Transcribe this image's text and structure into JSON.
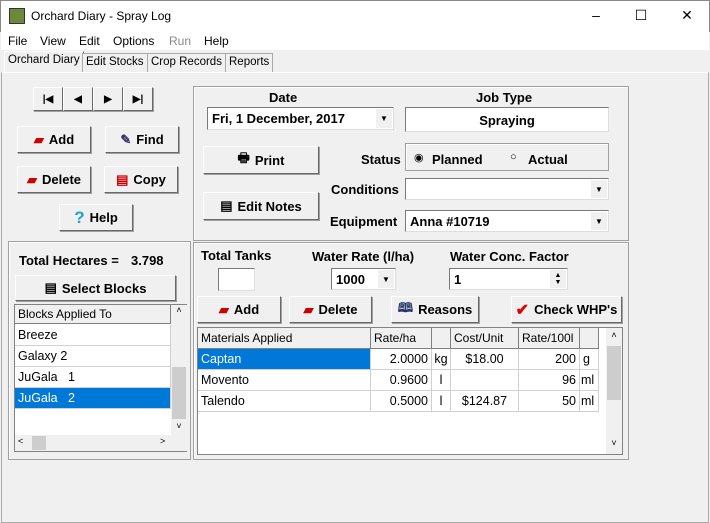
{
  "window": {
    "title": "Orchard Diary - Spray Log",
    "controls": [
      "–",
      "☐",
      "✕"
    ]
  },
  "menu": [
    "File",
    "View",
    "Edit",
    "Options",
    "Run",
    "Help"
  ],
  "tabs": [
    "Orchard Diary",
    "Edit Stocks",
    "Crop Records",
    "Reports"
  ],
  "nav": [
    "|◀",
    "◀",
    "▶",
    "▶|"
  ],
  "left_buttons": {
    "add": "Add",
    "find": "Find",
    "delete": "Delete",
    "copy": "Copy",
    "help": "Help"
  },
  "record": {
    "date_label": "Date",
    "date_value": "Fri, 1 December, 2017",
    "job_type_label": "Job Type",
    "job_type_value": "Spraying",
    "print": "Print",
    "edit_notes": "Edit Notes",
    "status_label": "Status",
    "status_options": [
      "Planned",
      "Actual"
    ],
    "status_selected": "Planned",
    "conditions_label": "Conditions",
    "conditions_value": "",
    "equipment_label": "Equipment",
    "equipment_value": "Anna #10719"
  },
  "blocks": {
    "total_label": "Total Hectares =",
    "total_value": "3.798",
    "select_button": "Select Blocks",
    "header": "Blocks Applied To",
    "items": [
      "Breeze",
      "Galaxy 2",
      "JuGala   1",
      "JuGala   2"
    ],
    "selected_index": 3
  },
  "spray": {
    "total_tanks_label": "Total Tanks",
    "total_tanks_value": "",
    "water_rate_label": "Water Rate (l/ha)",
    "water_rate_value": "1000",
    "water_conc_label": "Water Conc. Factor",
    "water_conc_value": "1",
    "add": "Add",
    "delete": "Delete",
    "reasons": "Reasons",
    "check": "Check WHP's"
  },
  "materials": {
    "columns": [
      "Materials Applied",
      "Rate/ha",
      "",
      "Cost/Unit",
      "Rate/100l",
      ""
    ],
    "rows": [
      [
        "Captan",
        "2.0000",
        "kg",
        "$18.00",
        "200",
        "g"
      ],
      [
        "Movento",
        "0.9600",
        "l",
        "",
        "96",
        "ml"
      ],
      [
        "Talendo",
        "0.5000",
        "l",
        "$124.87",
        "50",
        "ml"
      ]
    ],
    "selected_index": 0
  },
  "colors": {
    "selection": "#0078d7"
  }
}
